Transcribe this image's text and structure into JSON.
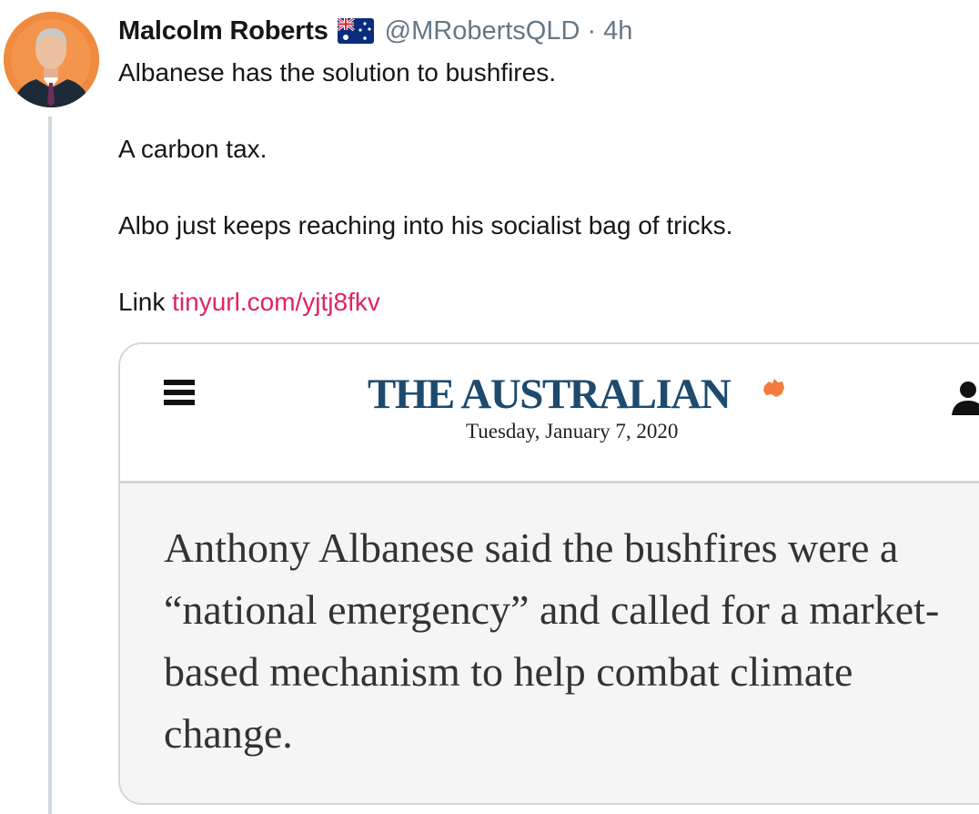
{
  "tweet": {
    "display_name": "Malcolm Roberts",
    "flag_icon": "australia-flag-icon",
    "handle": "@MRobertsQLD",
    "separator": "·",
    "time": "4h",
    "lines": [
      "Albanese has the solution to bushfires.",
      "A carbon tax.",
      "Albo just keeps reaching into his socialist bag of tricks."
    ],
    "link_prefix": "Link",
    "link_text": "tinyurl.com/yjtj8fkv",
    "colors": {
      "link": "#e0245e",
      "handle": "#657786",
      "thread_line": "#cfd9de"
    }
  },
  "card": {
    "masthead": "THE AUSTRALIAN",
    "date": "Tuesday, January 7, 2020",
    "headline": "Anthony Albanese said the bushfires were a “national emergency” and called for a market-based mechanism to help combat climate change.",
    "icons": {
      "menu": "hamburger-menu-icon",
      "account": "user-account-icon",
      "logo": "australia-map-icon"
    },
    "colors": {
      "masthead": "#1e4a6d",
      "logo": "#f47c3c"
    }
  }
}
